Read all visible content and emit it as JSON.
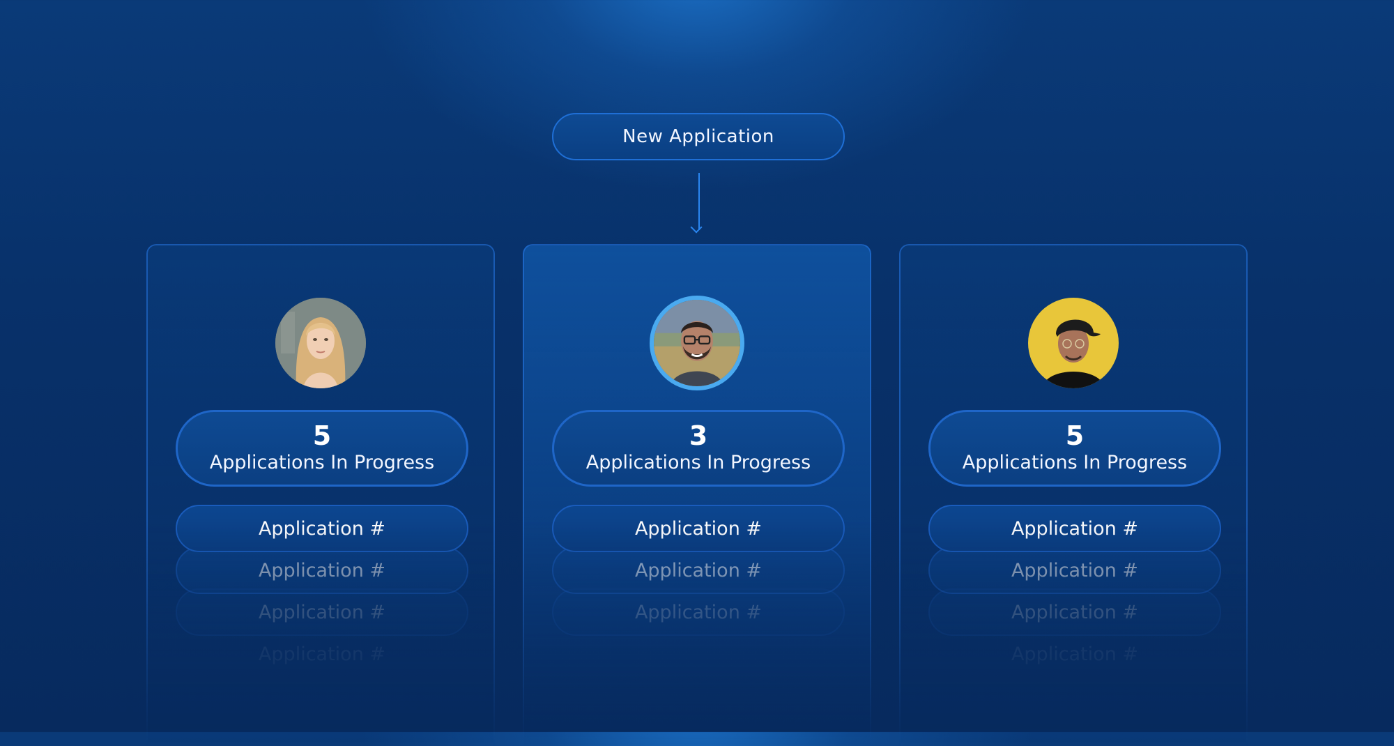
{
  "top": {
    "label": "New Application"
  },
  "colors": {
    "accent": "#2a86f0",
    "ring": "#4aaaf0",
    "avatar_bg_yellow": "#e8c63a"
  },
  "cards": [
    {
      "avatar": "woman-blonde-avatar",
      "count": "5",
      "count_label": "Applications In Progress",
      "apps": [
        "Application #",
        "Application #",
        "Application #",
        "Application #"
      ]
    },
    {
      "avatar": "man-glasses-avatar",
      "count": "3",
      "count_label": "Applications In Progress",
      "apps": [
        "Application #",
        "Application #",
        "Application #"
      ]
    },
    {
      "avatar": "man-cap-avatar",
      "count": "5",
      "count_label": "Applications In Progress",
      "apps": [
        "Application #",
        "Application #",
        "Application #",
        "Application #"
      ]
    }
  ]
}
